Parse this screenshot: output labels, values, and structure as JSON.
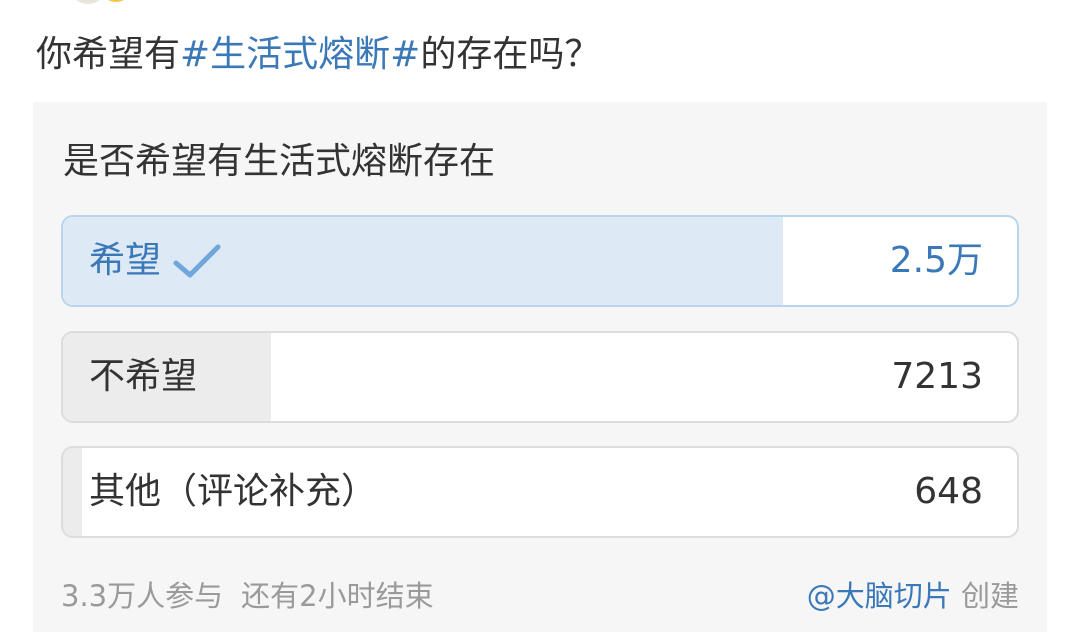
{
  "post": {
    "text_before": "你希望有",
    "topic": "#生活式熔断#",
    "text_after": "的存在吗？"
  },
  "poll": {
    "title": "是否希望有生活式熔断存在",
    "options": [
      {
        "label": "希望",
        "count": "2.5万",
        "fill_percent": 75.5,
        "selected": true
      },
      {
        "label": "不希望",
        "count": "7213",
        "fill_percent": 21.8,
        "selected": false
      },
      {
        "label": "其他（评论补充）",
        "count": "648",
        "fill_percent": 2.0,
        "selected": false
      }
    ],
    "participants": "3.3万人参与",
    "remaining": "还有2小时结束",
    "creator": "@大脑切片",
    "creator_suffix": "创建"
  },
  "colors": {
    "accent": "#3a78b8",
    "selected_fill": "#dde9f5",
    "option_fill": "#ececec",
    "card_bg": "#f6f6f6"
  },
  "icons": {
    "check": "check-icon"
  }
}
